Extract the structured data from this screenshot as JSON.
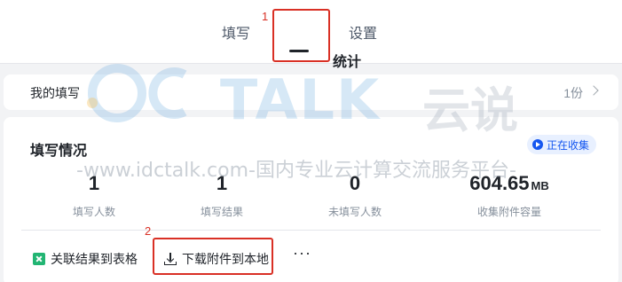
{
  "tabs": [
    {
      "label": "填写"
    },
    {
      "label": "统计"
    },
    {
      "label": "设置"
    }
  ],
  "annotations": {
    "tab_marker": "1",
    "download_marker": "2"
  },
  "my_fill": {
    "label": "我的填写",
    "count": "1份"
  },
  "status_card": {
    "title": "填写情况",
    "badge": "正在收集",
    "stats": [
      {
        "value": "1",
        "unit": "",
        "label": "填写人数"
      },
      {
        "value": "1",
        "unit": "",
        "label": "填写结果"
      },
      {
        "value": "0",
        "unit": "",
        "label": "未填写人数"
      },
      {
        "value": "604.65",
        "unit": "MB",
        "label": "收集附件容量"
      }
    ],
    "actions": {
      "link_sheet": "关联结果到表格",
      "download": "下载附件到本地",
      "more": "···"
    }
  },
  "watermark": {
    "brand": "TALK",
    "brand_cn": "云说",
    "url": "-www.idctalk.com-国内专业云计算交流服务平台-"
  },
  "colors": {
    "accent": "#1456f0",
    "highlight": "#d93025",
    "sheet": "#22b573"
  }
}
